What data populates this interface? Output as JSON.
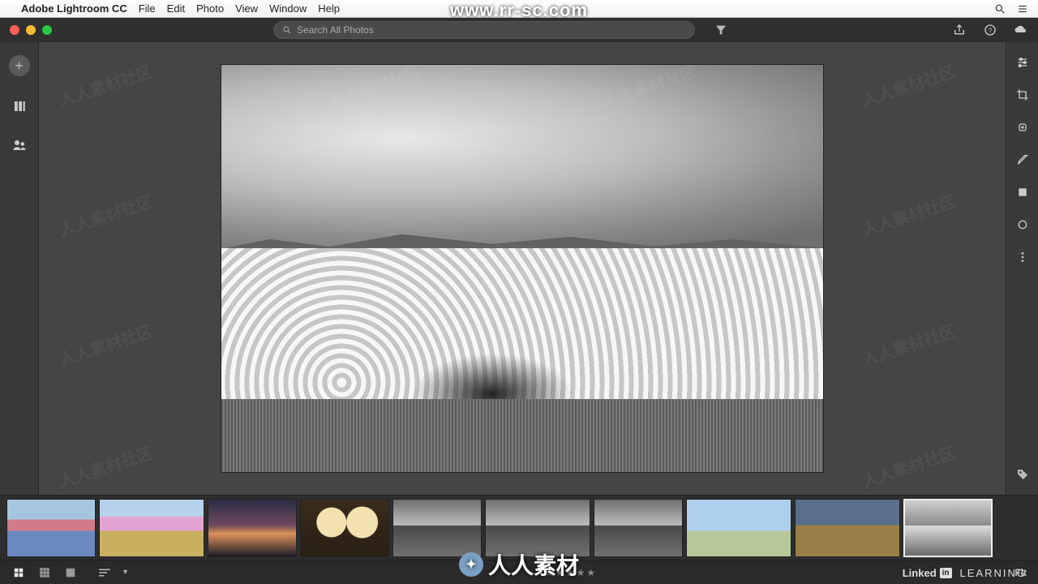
{
  "mac_menu": {
    "app_name": "Adobe Lightroom CC",
    "items": [
      "File",
      "Edit",
      "Photo",
      "View",
      "Window",
      "Help"
    ]
  },
  "search": {
    "placeholder": "Search All Photos"
  },
  "left_rail": {
    "add_label": "+",
    "items": [
      "my-photos",
      "shared"
    ]
  },
  "right_rail": {
    "tools": [
      "edit-sliders",
      "crop",
      "healing",
      "brush",
      "linear-gradient",
      "radial-gradient",
      "more"
    ]
  },
  "filmstrip": {
    "thumbs": [
      {
        "name": "thumb-houses-1",
        "cls": "th-color1"
      },
      {
        "name": "thumb-houses-2",
        "cls": "th-color2"
      },
      {
        "name": "thumb-sunset",
        "cls": "th-sunset"
      },
      {
        "name": "thumb-arches",
        "cls": "th-arch"
      },
      {
        "name": "thumb-clouds-1",
        "cls": "th-cloud"
      },
      {
        "name": "thumb-clouds-2",
        "cls": "th-cloud"
      },
      {
        "name": "thumb-clouds-3",
        "cls": "th-cloud"
      },
      {
        "name": "thumb-church",
        "cls": "th-church"
      },
      {
        "name": "thumb-field",
        "cls": "th-field"
      },
      {
        "name": "thumb-bw-trees",
        "cls": "th-bw",
        "selected": true
      }
    ]
  },
  "bottom": {
    "stars": "★★★★★",
    "fit_label": "Fit"
  },
  "watermark": {
    "url": "www.rr-sc.com",
    "text_cn": "人人素材",
    "tile": "人人素材社区",
    "brand1": "Linked",
    "brand1_box": "in",
    "brand2": "LEARNING"
  }
}
